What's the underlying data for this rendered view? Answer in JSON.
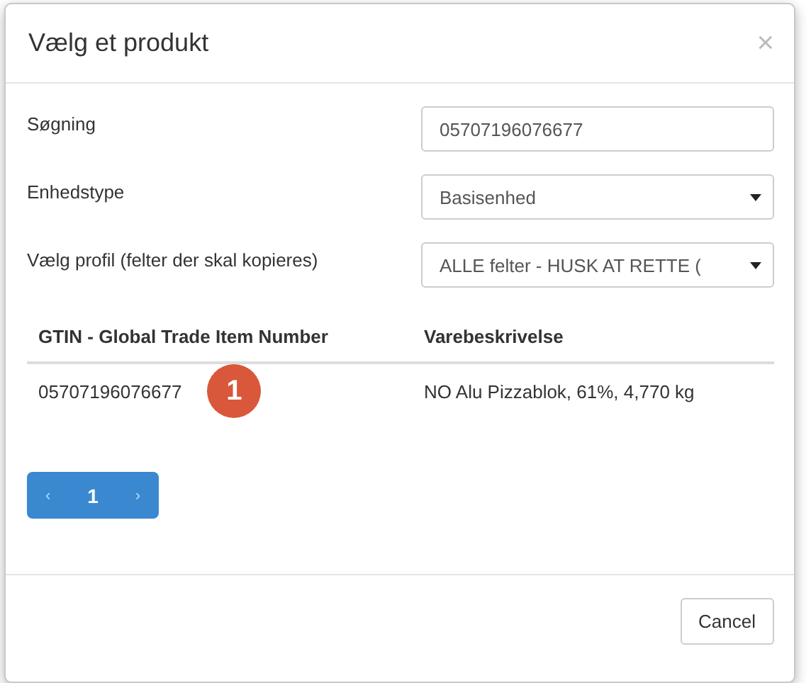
{
  "dialog": {
    "title": "Vælg et produkt",
    "close": "×"
  },
  "fields": [
    {
      "kind": "input",
      "label": "Søgning",
      "value": "05707196076677"
    },
    {
      "kind": "select",
      "label": "Enhedstype",
      "value": "Basisenhed"
    },
    {
      "kind": "select",
      "label": "Vælg profil (felter der skal kopieres)",
      "value": "ALLE felter - HUSK AT RETTE ("
    }
  ],
  "table": {
    "columns": [
      "GTIN - Global Trade Item Number",
      "Varebeskrivelse"
    ],
    "rows": [
      {
        "cells": [
          "05707196076677",
          "NO Alu Pizzablok, 61%, 4,770 kg"
        ],
        "badge": "1"
      }
    ]
  },
  "pagination": {
    "prev": "‹",
    "pages": [
      {
        "label": "1",
        "selected": true
      }
    ],
    "next": "›"
  },
  "buttons": [
    "Cancel"
  ]
}
